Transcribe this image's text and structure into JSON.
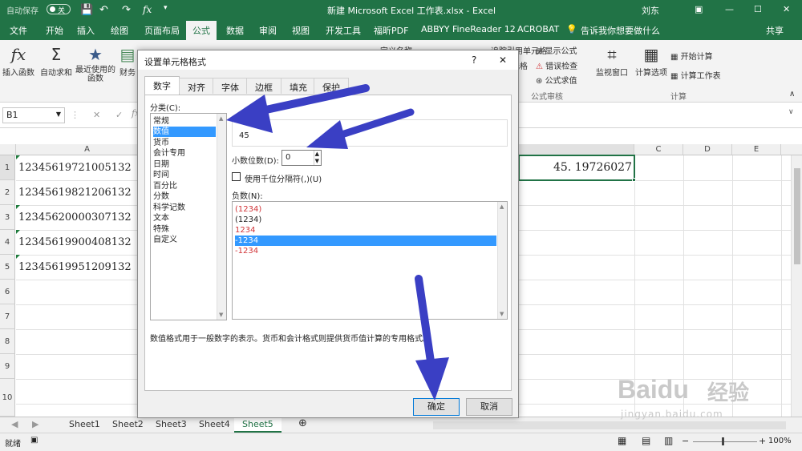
{
  "titlebar": {
    "autosave": "自动保存",
    "toggle_state": "关",
    "title": "新建 Microsoft Excel 工作表.xlsx - Excel",
    "user": "刘东",
    "colors": {
      "bar": "#217346"
    }
  },
  "ribbon": {
    "tabs": [
      "文件",
      "开始",
      "插入",
      "绘图",
      "页面布局",
      "公式",
      "数据",
      "审阅",
      "视图",
      "开发工具",
      "福昕PDF",
      "ABBYY FineReader 12",
      "ACROBAT"
    ],
    "active_tab": "公式",
    "tell_me": "告诉我你想要做什么",
    "share": "共享",
    "buttons": {
      "insert_function": "插入函数",
      "autosum": "自动求和",
      "recent": "最近使用的\n函数",
      "finance": "财务",
      "show_formulas": "显示公式",
      "error_check": "错误检查",
      "evaluate": "公式求值",
      "watch": "监视窗口",
      "calc_options": "计算选项",
      "calc_now": "开始计算",
      "calc_sheet": "计算工作表"
    },
    "trace_partial": "追踪引用单元格",
    "trace_partial2": "元格",
    "define_partial": "定义名称",
    "groups": {
      "audit": "公式审核",
      "calc": "计算"
    }
  },
  "formula_bar": {
    "name_box": "B1",
    "fx": "fx",
    "cancel": "✕",
    "enter": "✓"
  },
  "grid": {
    "columns": [
      "A",
      "C",
      "D",
      "E"
    ],
    "rows": [
      "1",
      "2",
      "3",
      "4",
      "5",
      "6",
      "7",
      "8",
      "9",
      "10"
    ],
    "cells": [
      "12345619721005132",
      "12345619821206132",
      "12345620000307132",
      "12345619900408132",
      "12345619951209132"
    ],
    "b1_value": "45. 19726027"
  },
  "sheets": {
    "tabs": [
      "Sheet1",
      "Sheet2",
      "Sheet3",
      "Sheet4",
      "Sheet5"
    ],
    "active": "Sheet5"
  },
  "status": {
    "ready": "就绪",
    "zoom": "100%"
  },
  "dialog": {
    "title": "设置单元格格式",
    "help": "?",
    "close": "✕",
    "tabs": [
      "数字",
      "对齐",
      "字体",
      "边框",
      "填充",
      "保护"
    ],
    "active_tab": "数字",
    "category_label": "分类(C):",
    "categories": [
      "常规",
      "数值",
      "货币",
      "会计专用",
      "日期",
      "时间",
      "百分比",
      "分数",
      "科学记数",
      "文本",
      "特殊",
      "自定义"
    ],
    "selected_category": "数值",
    "sample_value": "45",
    "decimal_label": "小数位数(D):",
    "decimal_value": "0",
    "thousands_label": "使用千位分隔符(,)(U)",
    "negative_label": "负数(N):",
    "negatives": [
      "(1234)",
      "(1234)",
      "1234",
      "-1234",
      "-1234"
    ],
    "negative_colors": [
      "#d13438",
      "#222222",
      "#d13438",
      "#ffffff",
      "#d13438"
    ],
    "selected_negative": 3,
    "description": "数值格式用于一般数字的表示。货币和会计格式则提供货币值计算的专用格式。",
    "ok": "确定",
    "cancel": "取消"
  },
  "watermark": {
    "brand": "Baidu",
    "brand2": "经验",
    "url": "jingyan.baidu.com"
  },
  "annotations": {
    "arrow_color": "#3a3fc4"
  }
}
